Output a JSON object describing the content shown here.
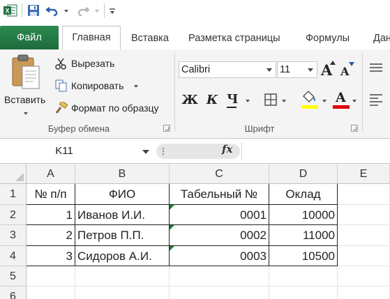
{
  "qat": {
    "icons": [
      "excel-app-icon",
      "save-icon",
      "undo-icon",
      "redo-icon",
      "customize-qat-icon"
    ]
  },
  "tabs": [
    {
      "label": "Файл"
    },
    {
      "label": "Главная"
    },
    {
      "label": "Вставка"
    },
    {
      "label": "Разметка страницы"
    },
    {
      "label": "Формулы"
    },
    {
      "label": "Дан"
    }
  ],
  "ribbon": {
    "clipboard": {
      "paste_label": "Вставить",
      "cut_label": "Вырезать",
      "copy_label": "Копировать",
      "format_painter_label": "Формат по образцу",
      "group_label": "Буфер обмена"
    },
    "font": {
      "font_name": "Calibri",
      "font_size": "11",
      "bold_label": "Ж",
      "italic_label": "К",
      "underline_label": "Ч",
      "grow_label": "A",
      "shrink_label": "A",
      "font_color_label": "A",
      "group_label": "Шрифт",
      "fill_color": "#ffff00",
      "font_color": "#e00000"
    }
  },
  "formula_bar": {
    "name_box": "K11",
    "fx_label": "fx",
    "formula": ""
  },
  "sheet": {
    "columns": [
      "A",
      "B",
      "C",
      "D",
      "E"
    ],
    "rows": [
      "1",
      "2",
      "3",
      "4",
      "5",
      "6"
    ],
    "header_row": [
      "№ п/п",
      "ФИО",
      "Табельный №",
      "Оклад"
    ],
    "data_rows": [
      [
        "1",
        "Иванов И.И.",
        "0001",
        "10000"
      ],
      [
        "2",
        "Петров П.П.",
        "0002",
        "11000"
      ],
      [
        "3",
        "Сидоров А.И.",
        "0003",
        "10500"
      ]
    ]
  },
  "colors": {
    "file_tab": "#217346",
    "ribbon_bg": "#f4f4f4",
    "header_bg": "#f2f2f2",
    "error_triangle": "#1f7a3a"
  }
}
